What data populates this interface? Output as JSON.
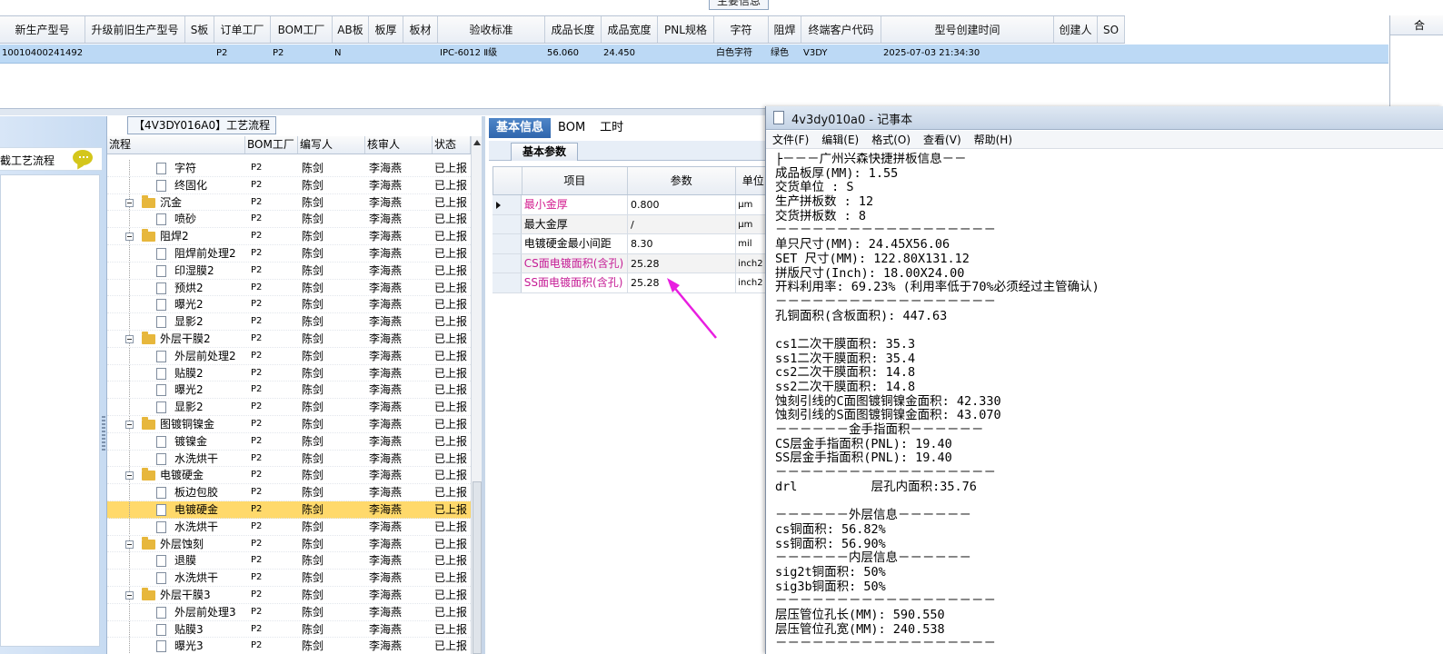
{
  "main_info": {
    "group_title": "主要信息",
    "columns": [
      {
        "label": "新生产型号",
        "w": 94
      },
      {
        "label": "升级前旧生产型号",
        "w": 110
      },
      {
        "label": "S板",
        "w": 32
      },
      {
        "label": "订单工厂",
        "w": 62
      },
      {
        "label": "BOM工厂",
        "w": 68
      },
      {
        "label": "AB板",
        "w": 40
      },
      {
        "label": "板厚",
        "w": 38
      },
      {
        "label": "板材",
        "w": 38
      },
      {
        "label": "验收标准",
        "w": 118
      },
      {
        "label": "成品长度",
        "w": 62
      },
      {
        "label": "成品宽度",
        "w": 62
      },
      {
        "label": "PNL规格",
        "w": 62
      },
      {
        "label": "字符",
        "w": 60
      },
      {
        "label": "阻焊",
        "w": 36
      },
      {
        "label": "终端客户代码",
        "w": 88
      },
      {
        "label": "型号创建时间",
        "w": 190
      },
      {
        "label": "创建人",
        "w": 48
      },
      {
        "label": "SO",
        "w": 30
      }
    ],
    "row": [
      "10010400241492",
      "",
      "",
      "P2",
      "P2",
      "N",
      "",
      "",
      "IPC-6012 Ⅱ级",
      "56.060",
      "24.450",
      "",
      "白色字符",
      "绿色",
      "V3DY",
      "2025-07-03 21:34:30",
      "",
      ""
    ],
    "right_header_stub": "合"
  },
  "nav": {
    "item_label": "截工艺流程"
  },
  "process": {
    "title": "【4V3DY016A0】工艺流程",
    "columns": [
      "流程",
      "BOM工厂",
      "编写人",
      "核审人",
      "状态"
    ],
    "rows": [
      {
        "name": "字符",
        "type": "child",
        "bom": "P2",
        "writer": "陈剑",
        "reviewer": "李海燕",
        "status": "已上报"
      },
      {
        "name": "终固化",
        "type": "child",
        "bom": "P2",
        "writer": "陈剑",
        "reviewer": "李海燕",
        "status": "已上报"
      },
      {
        "name": "沉金",
        "type": "group",
        "bom": "P2",
        "writer": "陈剑",
        "reviewer": "李海燕",
        "status": "已上报"
      },
      {
        "name": "喷砂",
        "type": "child",
        "bom": "P2",
        "writer": "陈剑",
        "reviewer": "李海燕",
        "status": "已上报"
      },
      {
        "name": "阻焊2",
        "type": "group",
        "bom": "P2",
        "writer": "陈剑",
        "reviewer": "李海燕",
        "status": "已上报"
      },
      {
        "name": "阻焊前处理2",
        "type": "child",
        "bom": "P2",
        "writer": "陈剑",
        "reviewer": "李海燕",
        "status": "已上报"
      },
      {
        "name": "印湿膜2",
        "type": "child",
        "bom": "P2",
        "writer": "陈剑",
        "reviewer": "李海燕",
        "status": "已上报"
      },
      {
        "name": "预烘2",
        "type": "child",
        "bom": "P2",
        "writer": "陈剑",
        "reviewer": "李海燕",
        "status": "已上报"
      },
      {
        "name": "曝光2",
        "type": "child",
        "bom": "P2",
        "writer": "陈剑",
        "reviewer": "李海燕",
        "status": "已上报"
      },
      {
        "name": "显影2",
        "type": "child",
        "bom": "P2",
        "writer": "陈剑",
        "reviewer": "李海燕",
        "status": "已上报"
      },
      {
        "name": "外层干膜2",
        "type": "group",
        "bom": "P2",
        "writer": "陈剑",
        "reviewer": "李海燕",
        "status": "已上报"
      },
      {
        "name": "外层前处理2",
        "type": "child",
        "bom": "P2",
        "writer": "陈剑",
        "reviewer": "李海燕",
        "status": "已上报"
      },
      {
        "name": "贴膜2",
        "type": "child",
        "bom": "P2",
        "writer": "陈剑",
        "reviewer": "李海燕",
        "status": "已上报"
      },
      {
        "name": "曝光2",
        "type": "child",
        "bom": "P2",
        "writer": "陈剑",
        "reviewer": "李海燕",
        "status": "已上报"
      },
      {
        "name": "显影2",
        "type": "child",
        "bom": "P2",
        "writer": "陈剑",
        "reviewer": "李海燕",
        "status": "已上报"
      },
      {
        "name": "图镀铜镍金",
        "type": "group",
        "bom": "P2",
        "writer": "陈剑",
        "reviewer": "李海燕",
        "status": "已上报"
      },
      {
        "name": "镀镍金",
        "type": "child",
        "bom": "P2",
        "writer": "陈剑",
        "reviewer": "李海燕",
        "status": "已上报"
      },
      {
        "name": "水洗烘干",
        "type": "child",
        "bom": "P2",
        "writer": "陈剑",
        "reviewer": "李海燕",
        "status": "已上报"
      },
      {
        "name": "电镀硬金",
        "type": "group",
        "bom": "P2",
        "writer": "陈剑",
        "reviewer": "李海燕",
        "status": "已上报"
      },
      {
        "name": "板边包胶",
        "type": "child",
        "bom": "P2",
        "writer": "陈剑",
        "reviewer": "李海燕",
        "status": "已上报"
      },
      {
        "name": "电镀硬金",
        "type": "child",
        "bom": "P2",
        "writer": "陈剑",
        "reviewer": "李海燕",
        "status": "已上报",
        "selected": true
      },
      {
        "name": "水洗烘干",
        "type": "child",
        "bom": "P2",
        "writer": "陈剑",
        "reviewer": "李海燕",
        "status": "已上报"
      },
      {
        "name": "外层蚀刻",
        "type": "group",
        "bom": "P2",
        "writer": "陈剑",
        "reviewer": "李海燕",
        "status": "已上报"
      },
      {
        "name": "退膜",
        "type": "child",
        "bom": "P2",
        "writer": "陈剑",
        "reviewer": "李海燕",
        "status": "已上报"
      },
      {
        "name": "水洗烘干",
        "type": "child",
        "bom": "P2",
        "writer": "陈剑",
        "reviewer": "李海燕",
        "status": "已上报"
      },
      {
        "name": "外层干膜3",
        "type": "group",
        "bom": "P2",
        "writer": "陈剑",
        "reviewer": "李海燕",
        "status": "已上报"
      },
      {
        "name": "外层前处理3",
        "type": "child",
        "bom": "P2",
        "writer": "陈剑",
        "reviewer": "李海燕",
        "status": "已上报"
      },
      {
        "name": "贴膜3",
        "type": "child",
        "bom": "P2",
        "writer": "陈剑",
        "reviewer": "李海燕",
        "status": "已上报"
      },
      {
        "name": "曝光3",
        "type": "child",
        "bom": "P2",
        "writer": "陈剑",
        "reviewer": "李海燕",
        "status": "已上报"
      }
    ]
  },
  "basic": {
    "tabs": [
      "基本信息",
      "BOM",
      "工时"
    ],
    "subtab": "基本参数",
    "columns": [
      "项目",
      "参数",
      "单位"
    ],
    "rows": [
      {
        "item": "最小金厚",
        "value": "0.800",
        "unit": "μm",
        "style": "pink",
        "current": true
      },
      {
        "item": "最大金厚",
        "value": "/",
        "unit": "μm",
        "style": ""
      },
      {
        "item": "电镀硬金最小间距",
        "value": "8.30",
        "unit": "mil",
        "style": ""
      },
      {
        "item": "CS面电镀面积(含孔)",
        "value": "25.28",
        "unit": "inch2",
        "style": "mag"
      },
      {
        "item": "SS面电镀面积(含孔)",
        "value": "25.28",
        "unit": "inch2",
        "style": "mag"
      }
    ]
  },
  "notepad": {
    "title": "4v3dy010a0 - 记事本",
    "menu": [
      "文件(F)",
      "编辑(E)",
      "格式(O)",
      "查看(V)",
      "帮助(H)"
    ],
    "lines": [
      "├－－－广州兴森快捷拼板信息－－",
      "成品板厚(MM): 1.55",
      "交货单位 : S",
      "生产拼板数 : 12",
      "交货拼板数 : 8",
      "－－－－－－－－－－－－－－－－－－",
      "单只尺寸(MM): 24.45X56.06",
      "SET 尺寸(MM): 122.80X131.12",
      "拼版尺寸(Inch): 18.00X24.00",
      "开料利用率: 69.23% (利用率低于70%必须经过主管确认)",
      "－－－－－－－－－－－－－－－－－－",
      "孔铜面积(含板面积): 447.63",
      "",
      "cs1二次干膜面积: 35.3",
      "ss1二次干膜面积: 35.4",
      "cs2二次干膜面积: 14.8",
      "ss2二次干膜面积: 14.8",
      "蚀刻引线的C面图镀铜镍金面积: 42.330",
      "蚀刻引线的S面图镀铜镍金面积: 43.070",
      "－－－－－－金手指面积－－－－－－",
      "CS层金手指面积(PNL): 19.40",
      "SS层金手指面积(PNL): 19.40",
      "－－－－－－－－－－－－－－－－－－",
      "drl          层孔内面积:35.76",
      "",
      "－－－－－－外层信息－－－－－－",
      "cs铜面积: 56.82%",
      "ss铜面积: 56.90%",
      "－－－－－－内层信息－－－－－－",
      "sig2t铜面积: 50%",
      "sig3b铜面积: 50%",
      "－－－－－－－－－－－－－－－－－－",
      "层压管位孔长(MM): 590.550",
      "层压管位孔宽(MM): 240.538",
      "－－－－－－－－－－－－－－－－－－"
    ]
  },
  "colors": {
    "selected_row": "#bcd9f5",
    "tree_selected": "#ffd96b",
    "arrow": "#e81ee0",
    "tab_active": "#2f66ad"
  }
}
